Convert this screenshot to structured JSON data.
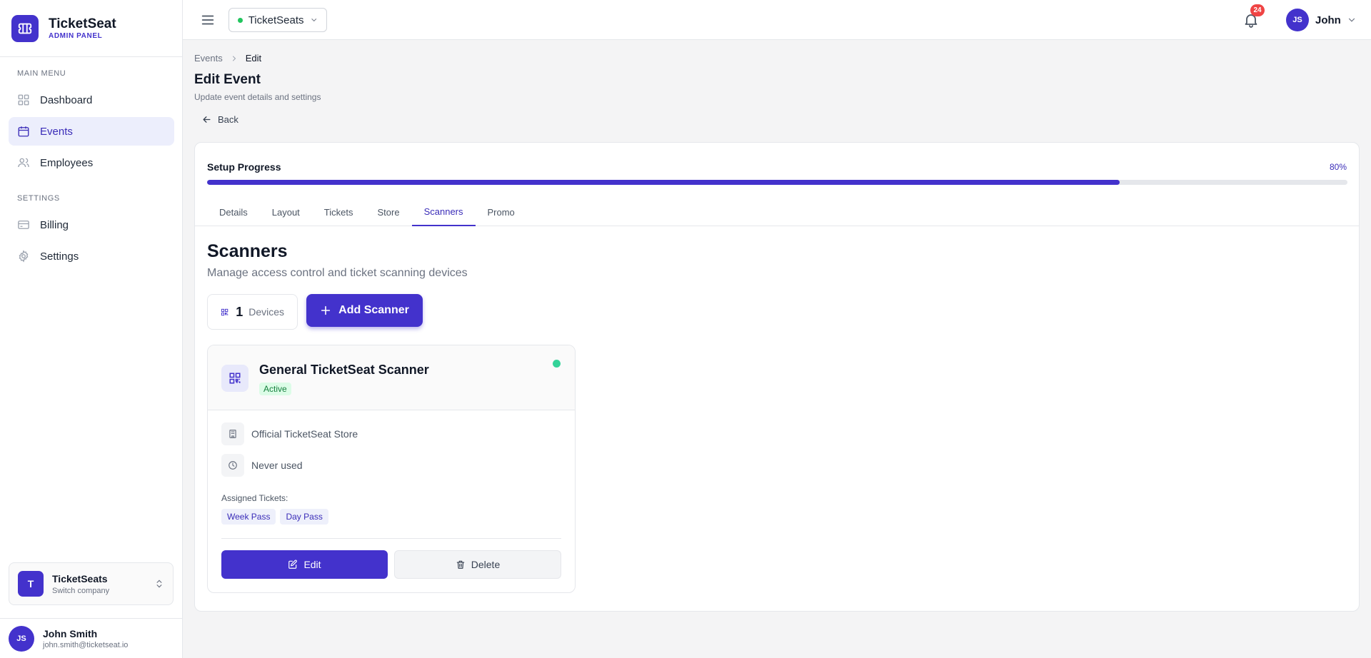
{
  "brand": {
    "name": "TicketSeat",
    "subtitle": "ADMIN PANEL",
    "logo_icon": "ticket-icon",
    "accent_color": "#4332cc"
  },
  "sidebar": {
    "main_menu_title": "MAIN MENU",
    "main_items": [
      {
        "label": "Dashboard",
        "icon": "grid-icon",
        "active": false
      },
      {
        "label": "Events",
        "icon": "calendar-icon",
        "active": true
      },
      {
        "label": "Employees",
        "icon": "users-icon",
        "active": false
      }
    ],
    "settings_title": "SETTINGS",
    "settings_items": [
      {
        "label": "Billing",
        "icon": "credit-card-icon"
      },
      {
        "label": "Settings",
        "icon": "gear-icon"
      }
    ],
    "company": {
      "initial": "T",
      "name": "TicketSeats",
      "subtitle": "Switch company"
    },
    "user": {
      "initials": "JS",
      "name": "John Smith",
      "email": "john.smith@ticketseat.io"
    }
  },
  "topbar": {
    "org_selector": "TicketSeats",
    "notifications_count": "24",
    "user_initials": "JS",
    "user_name": "John"
  },
  "breadcrumb": {
    "parent": "Events",
    "current": "Edit"
  },
  "page": {
    "title": "Edit Event",
    "subtitle": "Update event details and settings",
    "back_label": "Back"
  },
  "progress": {
    "title": "Setup Progress",
    "percent_label": "80%",
    "value": 0.8
  },
  "tabs": [
    "Details",
    "Layout",
    "Tickets",
    "Store",
    "Scanners",
    "Promo"
  ],
  "active_tab": "Scanners",
  "scanners": {
    "title": "Scanners",
    "subtitle": "Manage access control and ticket scanning devices",
    "device_count": "1",
    "device_label": "Devices",
    "add_button": "Add Scanner"
  },
  "scanner_card": {
    "name": "General TicketSeat Scanner",
    "status": "Active",
    "store": "Official TicketSeat Store",
    "last_used": "Never used",
    "assigned_label": "Assigned Tickets:",
    "tickets": [
      "Week Pass",
      "Day Pass"
    ],
    "edit_label": "Edit",
    "delete_label": "Delete",
    "status_color": "#34d399"
  }
}
